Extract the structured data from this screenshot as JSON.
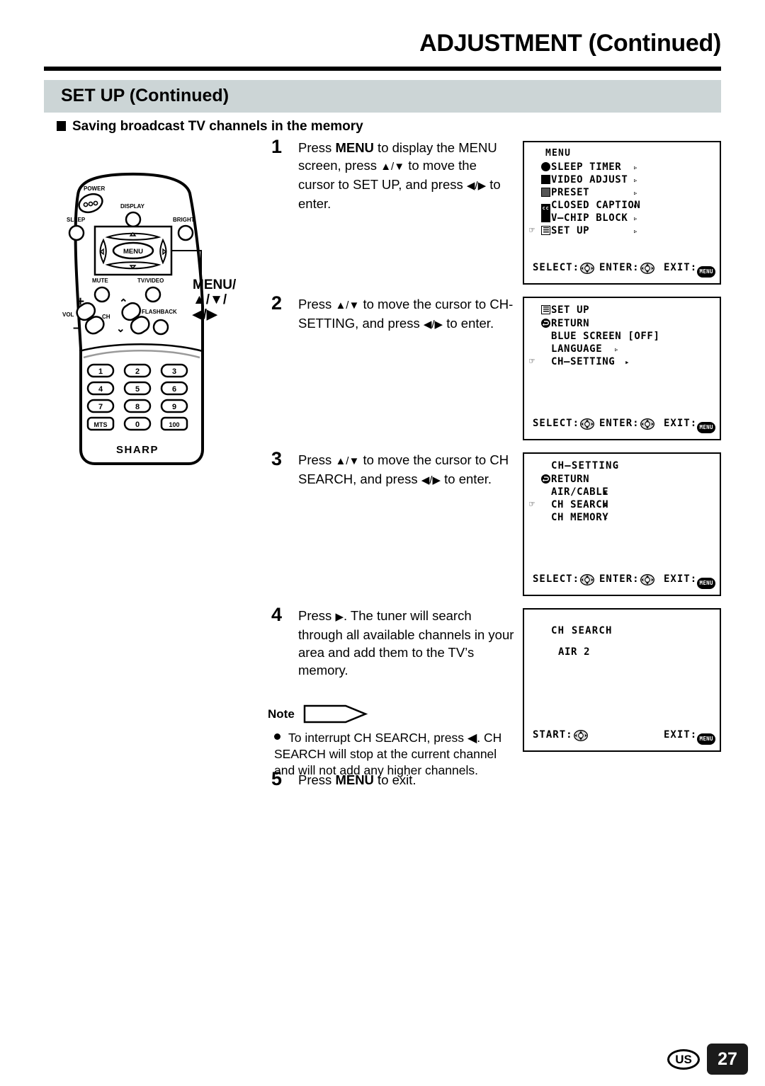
{
  "header": {
    "doc_title": "ADJUSTMENT (Continued)",
    "section_title": "SET UP (Continued)",
    "subhead": "Saving broadcast TV channels in the memory"
  },
  "steps": [
    {
      "num": "1",
      "text_parts": [
        "Press ",
        "MENU",
        " to display the MENU screen, press ",
        "▲/▼",
        " to move the cursor to SET UP, and press ",
        "◀/▶",
        " to enter."
      ]
    },
    {
      "num": "2",
      "text_parts": [
        "Press ",
        "▲/▼",
        " to move the cursor to CH-SETTING, and press ",
        "◀/▶",
        " to enter."
      ]
    },
    {
      "num": "3",
      "text_parts": [
        "Press ",
        "▲/▼",
        " to move the cursor to CH SEARCH, and press ",
        "◀/▶",
        " to enter."
      ]
    },
    {
      "num": "4",
      "text_parts": [
        "Press ",
        "▶",
        ". The tuner will search through all available channels in your area and add them to the TV’s memory."
      ]
    },
    {
      "num": "5",
      "text_parts": [
        "Press ",
        "MENU",
        " to exit."
      ]
    }
  ],
  "note": {
    "label": "Note",
    "bullet_text": "To interrupt CH SEARCH, press ◀. CH SEARCH will stop at the current channel and will not add any higher channels."
  },
  "remote": {
    "brand": "SHARP",
    "buttons": {
      "power": "POWER",
      "display": "DISPLAY",
      "sleep": "SLEEP",
      "bright": "BRIGHT",
      "menu": "MENU",
      "mute": "MUTE",
      "tv_video": "TV/VIDEO",
      "flashback": "FLASHBACK",
      "vol": "VOL",
      "ch": "CH",
      "vol_plus": "+",
      "vol_minus": "–",
      "ch_up": "⌃",
      "ch_down": "⌄"
    },
    "keypad": [
      "1",
      "2",
      "3",
      "4",
      "5",
      "6",
      "7",
      "8",
      "9",
      "MTS",
      "0",
      "100"
    ],
    "callout": [
      "MENU/",
      "▲/▼/",
      "◀/▶"
    ]
  },
  "osd_screens": [
    {
      "name": "menu-screen",
      "title": "MENU",
      "rows": [
        {
          "icon": "clock-icon",
          "label": "SLEEP TIMER",
          "arrow": "▹",
          "cursor": false
        },
        {
          "icon": "monitor-icon",
          "label": "VIDEO ADJUST",
          "arrow": "▹",
          "cursor": false
        },
        {
          "icon": "preset-icon",
          "label": "PRESET",
          "arrow": "▹",
          "cursor": false
        },
        {
          "icon": "cc-icon",
          "label": "CLOSED CAPTION",
          "arrow": "▸",
          "cursor": false
        },
        {
          "icon": "lock-icon",
          "label": "V–CHIP BLOCK",
          "arrow": "▹",
          "cursor": false
        },
        {
          "icon": "list-icon",
          "label": "SET UP",
          "arrow": "▹",
          "cursor": true
        }
      ],
      "bottom": [
        {
          "label": "SELECT:",
          "pad": "dpad-icon"
        },
        {
          "label": "ENTER:",
          "pad": "dpad-icon"
        },
        {
          "label": "EXIT:",
          "pad": "menu-button-icon",
          "pad_text": "MENU"
        }
      ]
    },
    {
      "name": "set-up-screen",
      "title": "SET UP",
      "title_icon": "list-icon",
      "rows": [
        {
          "icon": "return-icon",
          "label": "RETURN",
          "arrow": "",
          "cursor": false
        },
        {
          "icon": "",
          "label": "BLUE SCREEN [OFF]",
          "arrow": "",
          "cursor": false
        },
        {
          "icon": "",
          "label": "LANGUAGE",
          "arrow": "▹",
          "cursor": false
        },
        {
          "icon": "",
          "label": "CH–SETTING",
          "arrow": "▸",
          "cursor": true
        }
      ],
      "bottom": [
        {
          "label": "SELECT:",
          "pad": "dpad-icon"
        },
        {
          "label": "ENTER:",
          "pad": "dpad-icon"
        },
        {
          "label": "EXIT:",
          "pad": "menu-button-icon",
          "pad_text": "MENU"
        }
      ]
    },
    {
      "name": "ch-setting-screen",
      "title": "CH–SETTING",
      "rows": [
        {
          "icon": "return-icon",
          "label": "RETURN",
          "arrow": "",
          "cursor": false
        },
        {
          "icon": "",
          "label": "AIR/CABLE",
          "arrow": "▸",
          "cursor": false
        },
        {
          "icon": "",
          "label": "CH SEARCH",
          "arrow": "▸",
          "cursor": true
        },
        {
          "icon": "",
          "label": "CH MEMORY",
          "arrow": "▸",
          "cursor": false
        }
      ],
      "bottom": [
        {
          "label": "SELECT:",
          "pad": "dpad-icon"
        },
        {
          "label": "ENTER:",
          "pad": "dpad-icon"
        },
        {
          "label": "EXIT:",
          "pad": "menu-button-icon",
          "pad_text": "MENU"
        }
      ]
    },
    {
      "name": "ch-search-screen",
      "title": "CH SEARCH",
      "value_line": "AIR   2",
      "bottom": [
        {
          "label": "START:",
          "pad": "dpad-icon"
        },
        {
          "label": "EXIT:",
          "pad": "menu-button-icon",
          "pad_text": "MENU"
        }
      ]
    }
  ],
  "footer": {
    "region": "US",
    "page_number": "27"
  },
  "colors": {
    "section_bar": "#ccd5d6",
    "ink": "#000000",
    "page_badge": "#1b1b1b"
  }
}
